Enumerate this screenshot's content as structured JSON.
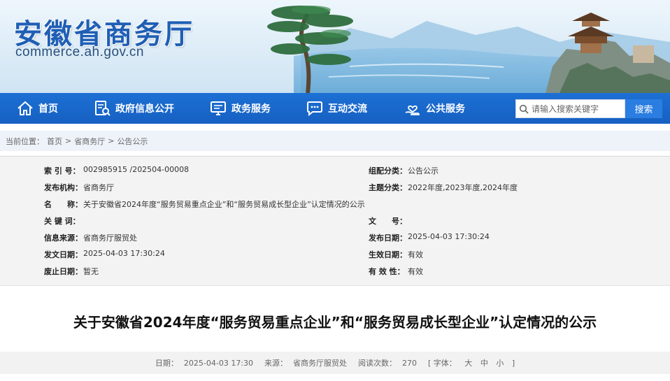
{
  "header": {
    "title": "安徽省商务厅",
    "domain": "commerce.ah.gov.cn"
  },
  "nav": {
    "items": [
      {
        "label": "首页",
        "icon": "home-icon"
      },
      {
        "label": "政府信息公开",
        "icon": "document-search-icon"
      },
      {
        "label": "政务服务",
        "icon": "monitor-icon"
      },
      {
        "label": "互动交流",
        "icon": "chat-bubble-icon"
      },
      {
        "label": "公共服务",
        "icon": "heart-hand-icon"
      }
    ],
    "search_placeholder": "请输入搜索关键字",
    "search_button": "搜索"
  },
  "breadcrumb": {
    "prefix": "当前位置：",
    "items": [
      "首页",
      "省商务厅",
      "公告公示"
    ],
    "separator": ">"
  },
  "meta": {
    "index_label": "索 引 号：",
    "index_value": "002985915 /202504-00008",
    "category_label": "组配分类：",
    "category_value": "公告公示",
    "publisher_label": "发布机构：",
    "publisher_value": "省商务厅",
    "topic_label": "主题分类：",
    "topic_value": "2022年度,2023年度,2024年度",
    "name_label": "名　　称：",
    "name_value": "关于安徽省2024年度“服务贸易重点企业”和“服务贸易成长型企业”认定情况的公示",
    "keyword_label": "关 键 词：",
    "keyword_value": "",
    "docno_label": "文　　号：",
    "docno_value": "",
    "source_label": "信息来源：",
    "source_value": "省商务厅服贸处",
    "pubdate_label": "发布日期：",
    "pubdate_value": "2025-04-03 17:30:24",
    "issuedate_label": "发文日期：",
    "issuedate_value": "2025-04-03 17:30:24",
    "effective_label": "生效日期：",
    "effective_value": "有效",
    "expiry_label": "废止日期：",
    "expiry_value": "暂无",
    "validity_label": "有 效 性：",
    "validity_value": "有效"
  },
  "article": {
    "title": "关于安徽省2024年度“服务贸易重点企业”和“服务贸易成长型企业”认定情况的公示",
    "date_label": "日期：",
    "date_value": "2025-04-03 17:30",
    "source_label": "来源：",
    "source_value": "省商务厅服贸处",
    "views_label": "阅读次数：",
    "views_value": "270",
    "font_label": "[ 字体：",
    "font_large": "大",
    "font_medium": "中",
    "font_small": "小",
    "font_close": "]"
  },
  "colors": {
    "nav_blue": "#1d70d4",
    "title_blue": "#1f5fb5",
    "search_button": "#2a7de1"
  }
}
